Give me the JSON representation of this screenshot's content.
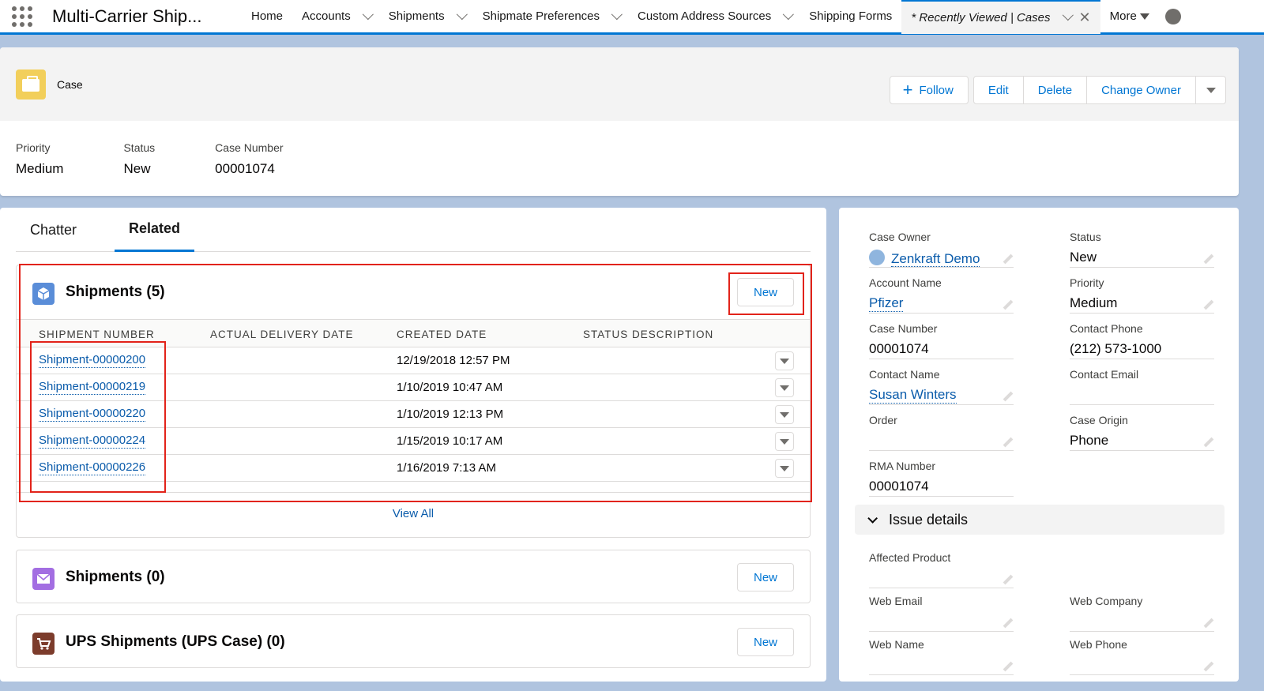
{
  "nav": {
    "app_name": "Multi-Carrier Ship...",
    "items": [
      {
        "label": "Home",
        "dropdown": false
      },
      {
        "label": "Accounts",
        "dropdown": true
      },
      {
        "label": "Shipments",
        "dropdown": true
      },
      {
        "label": "Shipmate Preferences",
        "dropdown": true
      },
      {
        "label": "Custom Address Sources",
        "dropdown": true
      },
      {
        "label": "Shipping Forms",
        "dropdown": false
      }
    ],
    "active_tab": "* Recently Viewed | Cases",
    "more_label": "More"
  },
  "header": {
    "object_label": "Case",
    "actions": {
      "follow": "Follow",
      "edit": "Edit",
      "delete": "Delete",
      "change_owner": "Change Owner"
    },
    "highlights": [
      {
        "label": "Priority",
        "value": "Medium"
      },
      {
        "label": "Status",
        "value": "New"
      },
      {
        "label": "Case Number",
        "value": "00001074"
      }
    ]
  },
  "tabs": [
    "Chatter",
    "Related"
  ],
  "related_lists": {
    "shipments": {
      "title": "Shipments (5)",
      "new_label": "New",
      "columns": [
        "SHIPMENT NUMBER",
        "ACTUAL DELIVERY DATE",
        "CREATED DATE",
        "STATUS DESCRIPTION"
      ],
      "rows": [
        {
          "number": "Shipment-00000200",
          "delivery": "",
          "created": "12/19/2018 12:57 PM",
          "status": ""
        },
        {
          "number": "Shipment-00000219",
          "delivery": "",
          "created": "1/10/2019 10:47 AM",
          "status": ""
        },
        {
          "number": "Shipment-00000220",
          "delivery": "",
          "created": "1/10/2019 12:13 PM",
          "status": ""
        },
        {
          "number": "Shipment-00000224",
          "delivery": "",
          "created": "1/15/2019 10:17 AM",
          "status": ""
        },
        {
          "number": "Shipment-00000226",
          "delivery": "",
          "created": "1/16/2019 7:13 AM",
          "status": ""
        }
      ],
      "view_all": "View All"
    },
    "shipments_0": {
      "title": "Shipments (0)",
      "new_label": "New"
    },
    "ups": {
      "title": "UPS Shipments (UPS Case) (0)",
      "new_label": "New"
    }
  },
  "details": {
    "case_owner": {
      "label": "Case Owner",
      "value": "Zenkraft Demo"
    },
    "status": {
      "label": "Status",
      "value": "New"
    },
    "account_name": {
      "label": "Account Name",
      "value": "Pfizer"
    },
    "priority": {
      "label": "Priority",
      "value": "Medium"
    },
    "case_number": {
      "label": "Case Number",
      "value": "00001074"
    },
    "contact_phone": {
      "label": "Contact Phone",
      "value": "(212) 573-1000"
    },
    "contact_name": {
      "label": "Contact Name",
      "value": "Susan Winters"
    },
    "contact_email": {
      "label": "Contact Email",
      "value": ""
    },
    "order": {
      "label": "Order",
      "value": ""
    },
    "case_origin": {
      "label": "Case Origin",
      "value": "Phone"
    },
    "rma_number": {
      "label": "RMA Number",
      "value": "00001074"
    },
    "issue_section": "Issue details",
    "affected_product": {
      "label": "Affected Product",
      "value": ""
    },
    "web_email": {
      "label": "Web Email",
      "value": ""
    },
    "web_company": {
      "label": "Web Company",
      "value": ""
    },
    "web_name": {
      "label": "Web Name",
      "value": ""
    },
    "web_phone": {
      "label": "Web Phone",
      "value": ""
    }
  },
  "colors": {
    "brand": "#0176d3",
    "link": "#0b5cab",
    "highlight_box": "#e2231a",
    "case_icon": "#f2cf5b"
  }
}
